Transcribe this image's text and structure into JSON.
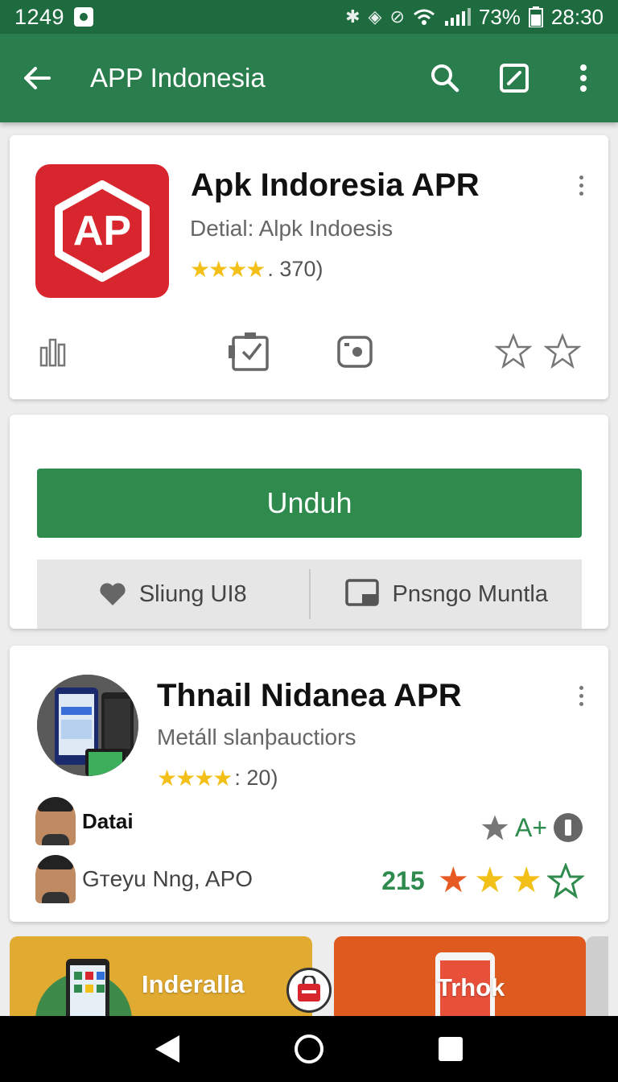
{
  "status_bar": {
    "time": "1249",
    "battery": "73%",
    "clock": "28:30"
  },
  "app_bar": {
    "title": "APP Indonesia"
  },
  "app_card": {
    "icon_text": "AP",
    "name": "Apk Indoresia APR",
    "subtitle": "Detial: Alpk Indoesis",
    "rating_text": ". 370)"
  },
  "actions": {
    "download_label": "Unduh",
    "left_label": "Sliung UI8",
    "right_label": "Pnsngo Muntla"
  },
  "featured": {
    "name": "Thnail Nidanea APR",
    "subtitle": "Metáll slanþauctiors",
    "rating_text": ": 20)",
    "person1": "Datai",
    "person2": "Gтeyu Nng, APO",
    "badge_text": "A+",
    "count": "215"
  },
  "tiles": {
    "left_label": "Inderalla",
    "right_label": "Trhok"
  },
  "colors": {
    "primary": "#2a7d4c",
    "download": "#2e8b4d",
    "app_icon": "#d8262e",
    "star": "#f2c018"
  }
}
